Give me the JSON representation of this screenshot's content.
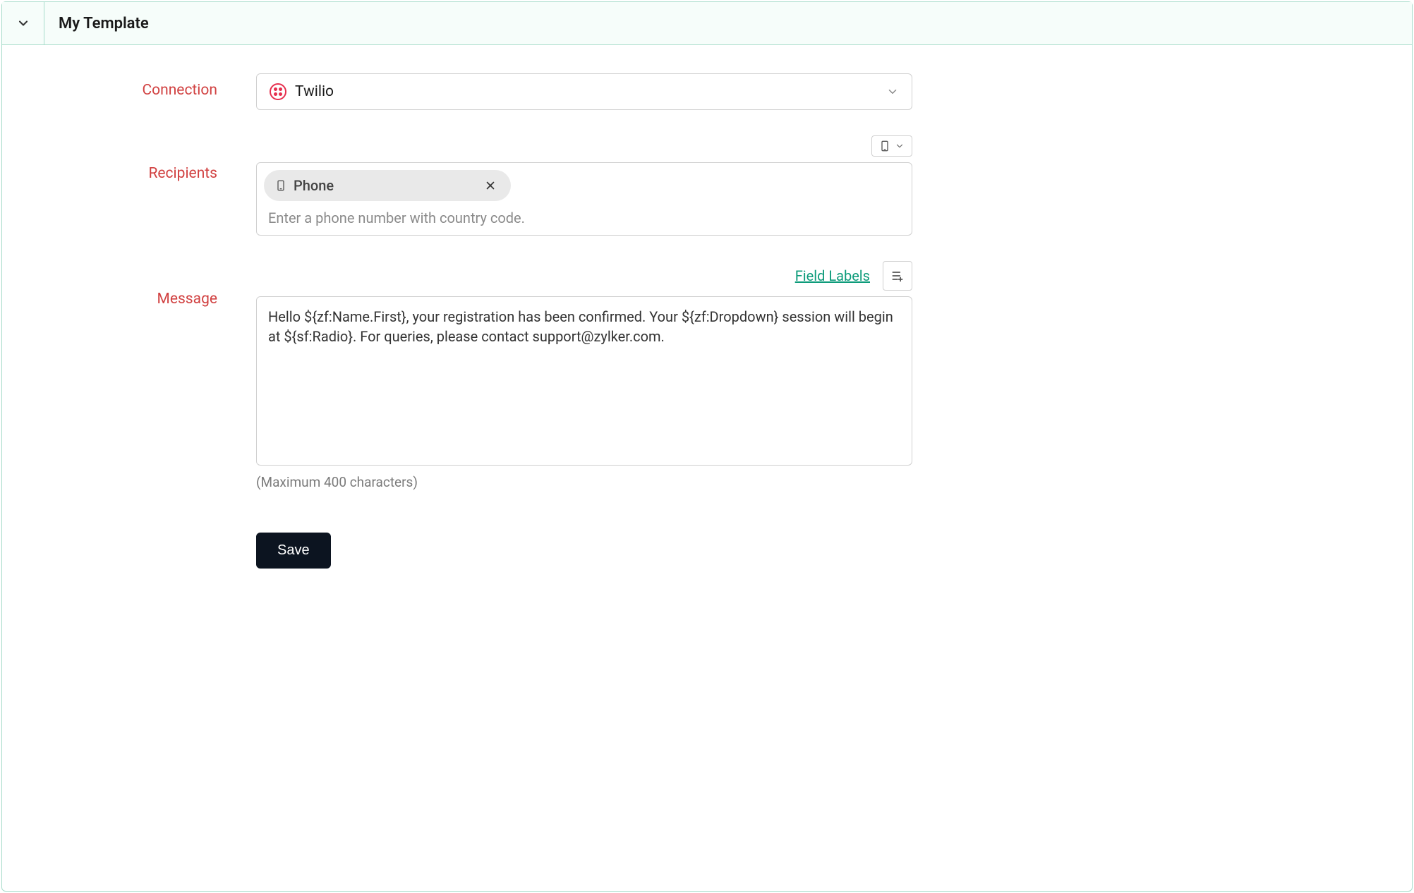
{
  "header": {
    "title": "My Template"
  },
  "connection": {
    "label": "Connection",
    "selected": "Twilio"
  },
  "recipients": {
    "label": "Recipients",
    "chip_text": "Phone",
    "placeholder": "Enter a phone number with country code."
  },
  "message": {
    "label": "Message",
    "field_labels_link": "Field Labels",
    "value": "Hello ${zf:Name.First}, your registration has been confirmed. Your ${zf:Dropdown} session will begin at ${sf:Radio}. For queries, please contact support@zylker.com.",
    "hint": "(Maximum 400 characters)"
  },
  "buttons": {
    "save": "Save"
  }
}
